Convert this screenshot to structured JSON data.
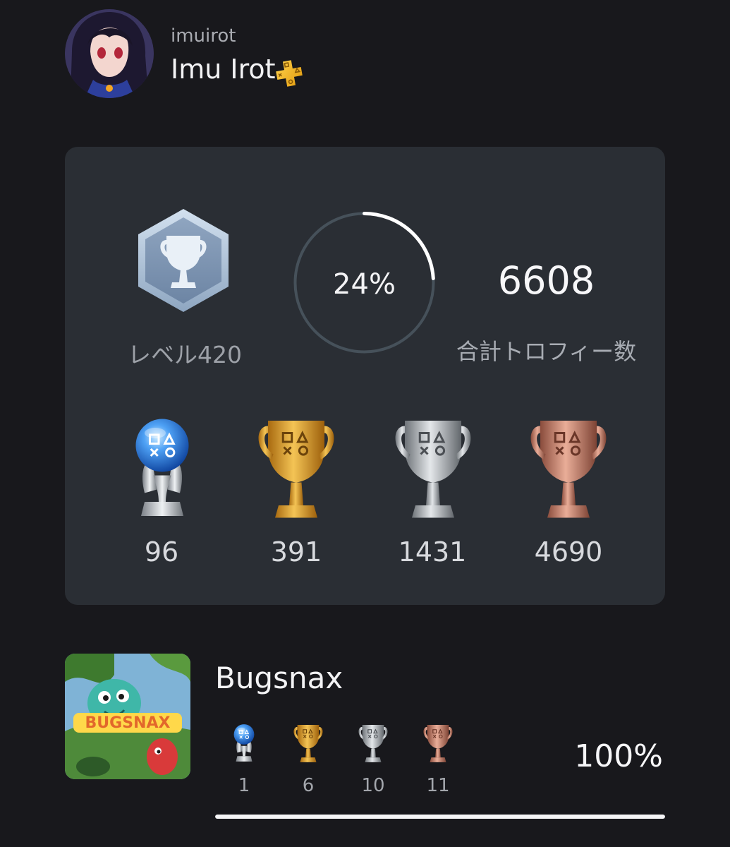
{
  "profile": {
    "online_id": "imuirot",
    "display_name": "Imu Irot",
    "plus_icon": "playstation-plus-icon",
    "avatar_icon": "avatar-anime-character"
  },
  "summary": {
    "level_label": "レベル420",
    "level_icon": "level-trophy-hexagon-icon",
    "level_progress_text": "24%",
    "level_progress": 0.24,
    "total_trophies": "6608",
    "total_trophies_label": "合計トロフィー数",
    "trophies": [
      {
        "type": "platinum",
        "count": "96",
        "icon": "platinum-trophy-icon",
        "color": "#5aa6ff"
      },
      {
        "type": "gold",
        "count": "391",
        "icon": "gold-trophy-icon",
        "color": "#e7a82c"
      },
      {
        "type": "silver",
        "count": "1431",
        "icon": "silver-trophy-icon",
        "color": "#b7bcc2"
      },
      {
        "type": "bronze",
        "count": "4690",
        "icon": "bronze-trophy-icon",
        "color": "#c98570"
      }
    ]
  },
  "games": [
    {
      "title": "Bugsnax",
      "cover_icon": "bugsnax-cover-art",
      "progress_text": "100%",
      "progress": 1.0,
      "trophies": [
        {
          "type": "platinum",
          "count": "1"
        },
        {
          "type": "gold",
          "count": "6"
        },
        {
          "type": "silver",
          "count": "10"
        },
        {
          "type": "bronze",
          "count": "11"
        }
      ]
    }
  ],
  "colors": {
    "background": "#18181c",
    "card": "#2a2e34",
    "ring_track": "#46515a",
    "ring_fill": "#ffffff"
  }
}
